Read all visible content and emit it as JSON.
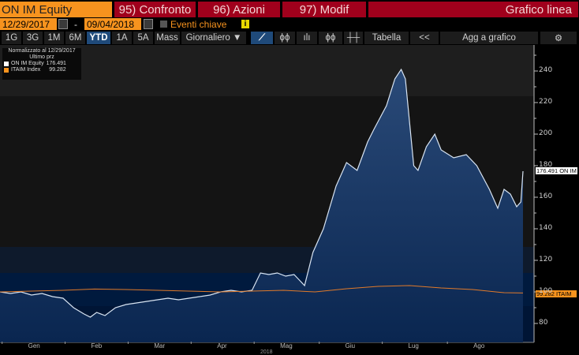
{
  "header": {
    "ticker": "ON IM Equity",
    "compare": "95) Confronto",
    "actions": "96) Azioni",
    "modify": "97) Modif",
    "chart_type": "Grafico linea"
  },
  "dates": {
    "start": "12/29/2017",
    "sep": "-",
    "end": "09/04/2018",
    "events": "Eventi chiave",
    "info": "i"
  },
  "toolbar": {
    "periods": [
      "1G",
      "3G",
      "1M",
      "6M",
      "YTD",
      "1A",
      "5A",
      "Mass"
    ],
    "frequency": "Giornaliero ▼",
    "table": "Tabella",
    "back": "<<",
    "add": "Agg a grafico",
    "settings": "⚙"
  },
  "legend": {
    "title": "Normalizzato al 12/29/2017",
    "subtitle": "Ultimo prz",
    "items": [
      {
        "name": "ON IM Equity",
        "value": "176.491",
        "color": "#ffffff"
      },
      {
        "name": "ITAIM Index",
        "value": "99.282",
        "color": "#f7931e"
      }
    ]
  },
  "colors": {
    "accent": "#f7931e",
    "section": "#a0001c"
  },
  "chart_data": {
    "type": "area",
    "xlabel": "2018",
    "ylim": [
      75,
      250
    ],
    "xlim": [
      0,
      249
    ],
    "yticks": [
      80,
      100,
      120,
      140,
      160,
      180,
      200,
      220,
      240
    ],
    "month_labels": [
      {
        "label": "Gen",
        "day": 16
      },
      {
        "label": "Feb",
        "day": 46
      },
      {
        "label": "Mar",
        "day": 76
      },
      {
        "label": "Apr",
        "day": 106
      },
      {
        "label": "Mag",
        "day": 136
      },
      {
        "label": "Giu",
        "day": 167
      },
      {
        "label": "Lug",
        "day": 197
      },
      {
        "label": "Ago",
        "day": 228
      }
    ],
    "last_labels": {
      "on": "176.491 ON IM",
      "itaim": "99.282 ITAIM"
    },
    "series": [
      {
        "name": "ON IM Equity",
        "x": [
          0,
          5,
          10,
          15,
          20,
          25,
          30,
          35,
          40,
          43,
          46,
          50,
          55,
          60,
          65,
          70,
          75,
          80,
          85,
          90,
          95,
          100,
          105,
          110,
          115,
          120,
          124,
          128,
          132,
          136,
          140,
          145,
          149,
          154,
          160,
          165,
          170,
          175,
          178,
          184,
          188,
          191,
          193,
          197,
          199,
          203,
          207,
          210,
          216,
          222,
          227,
          233,
          237,
          240,
          243,
          246,
          248,
          249
        ],
        "y": [
          100,
          99,
          100,
          98,
          99,
          97,
          96,
          90,
          86,
          84,
          87,
          85,
          90,
          92,
          93,
          94,
          95,
          96,
          95,
          96,
          97,
          98,
          100,
          101,
          100,
          101,
          112,
          111,
          112,
          110,
          111,
          104,
          125,
          140,
          167,
          182,
          177,
          195,
          203,
          218,
          235,
          241,
          235,
          180,
          177,
          192,
          200,
          190,
          185,
          187,
          180,
          165,
          153,
          165,
          162,
          154,
          157,
          176.491
        ]
      },
      {
        "name": "ITAIM Index",
        "x": [
          0,
          15,
          30,
          45,
          60,
          75,
          90,
          105,
          120,
          135,
          150,
          165,
          180,
          195,
          210,
          225,
          240,
          249
        ],
        "y": [
          100,
          100.5,
          101,
          101.8,
          101.5,
          101,
          100.5,
          100,
          100.5,
          101,
          100,
          102,
          103.5,
          104,
          102.5,
          101.5,
          99.5,
          99.282
        ]
      }
    ]
  }
}
